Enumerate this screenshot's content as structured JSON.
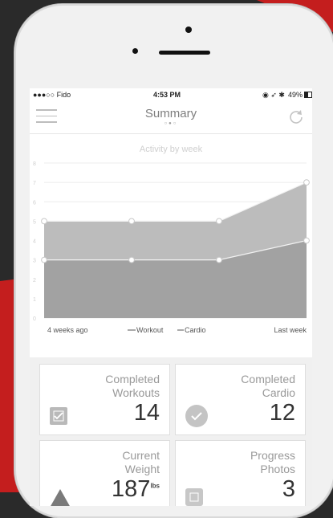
{
  "status": {
    "carrier": "●●●○○ Fido",
    "time": "4:53 PM",
    "battery": "49%"
  },
  "header": {
    "title": "Summary",
    "page_dots": "○●○"
  },
  "chart_data": {
    "type": "area",
    "title": "Activity by week",
    "x_labels": [
      "4 weeks ago",
      "",
      "",
      "Last week"
    ],
    "series": [
      {
        "name": "Workout",
        "values": [
          5,
          5,
          5,
          7
        ]
      },
      {
        "name": "Cardio",
        "values": [
          3,
          3,
          3,
          4
        ]
      }
    ],
    "ylim": [
      0,
      8
    ],
    "yticks": [
      0,
      1,
      2,
      3,
      4,
      5,
      6,
      7,
      8
    ],
    "grid": true,
    "legend": {
      "placement": "bottom-center",
      "workout_label": "Workout",
      "cardio_label": "Cardio"
    },
    "colors": {
      "workout": "#bcbcbc",
      "cardio": "#a2a2a2"
    }
  },
  "cards": {
    "workouts": {
      "label": "Completed\nWorkouts",
      "value": "14"
    },
    "cardio": {
      "label": "Completed\nCardio",
      "value": "12"
    },
    "weight": {
      "label": "Current\nWeight",
      "value": "187",
      "unit": "lbs"
    },
    "photos": {
      "label": "Progress\nPhotos",
      "value": "3"
    }
  }
}
